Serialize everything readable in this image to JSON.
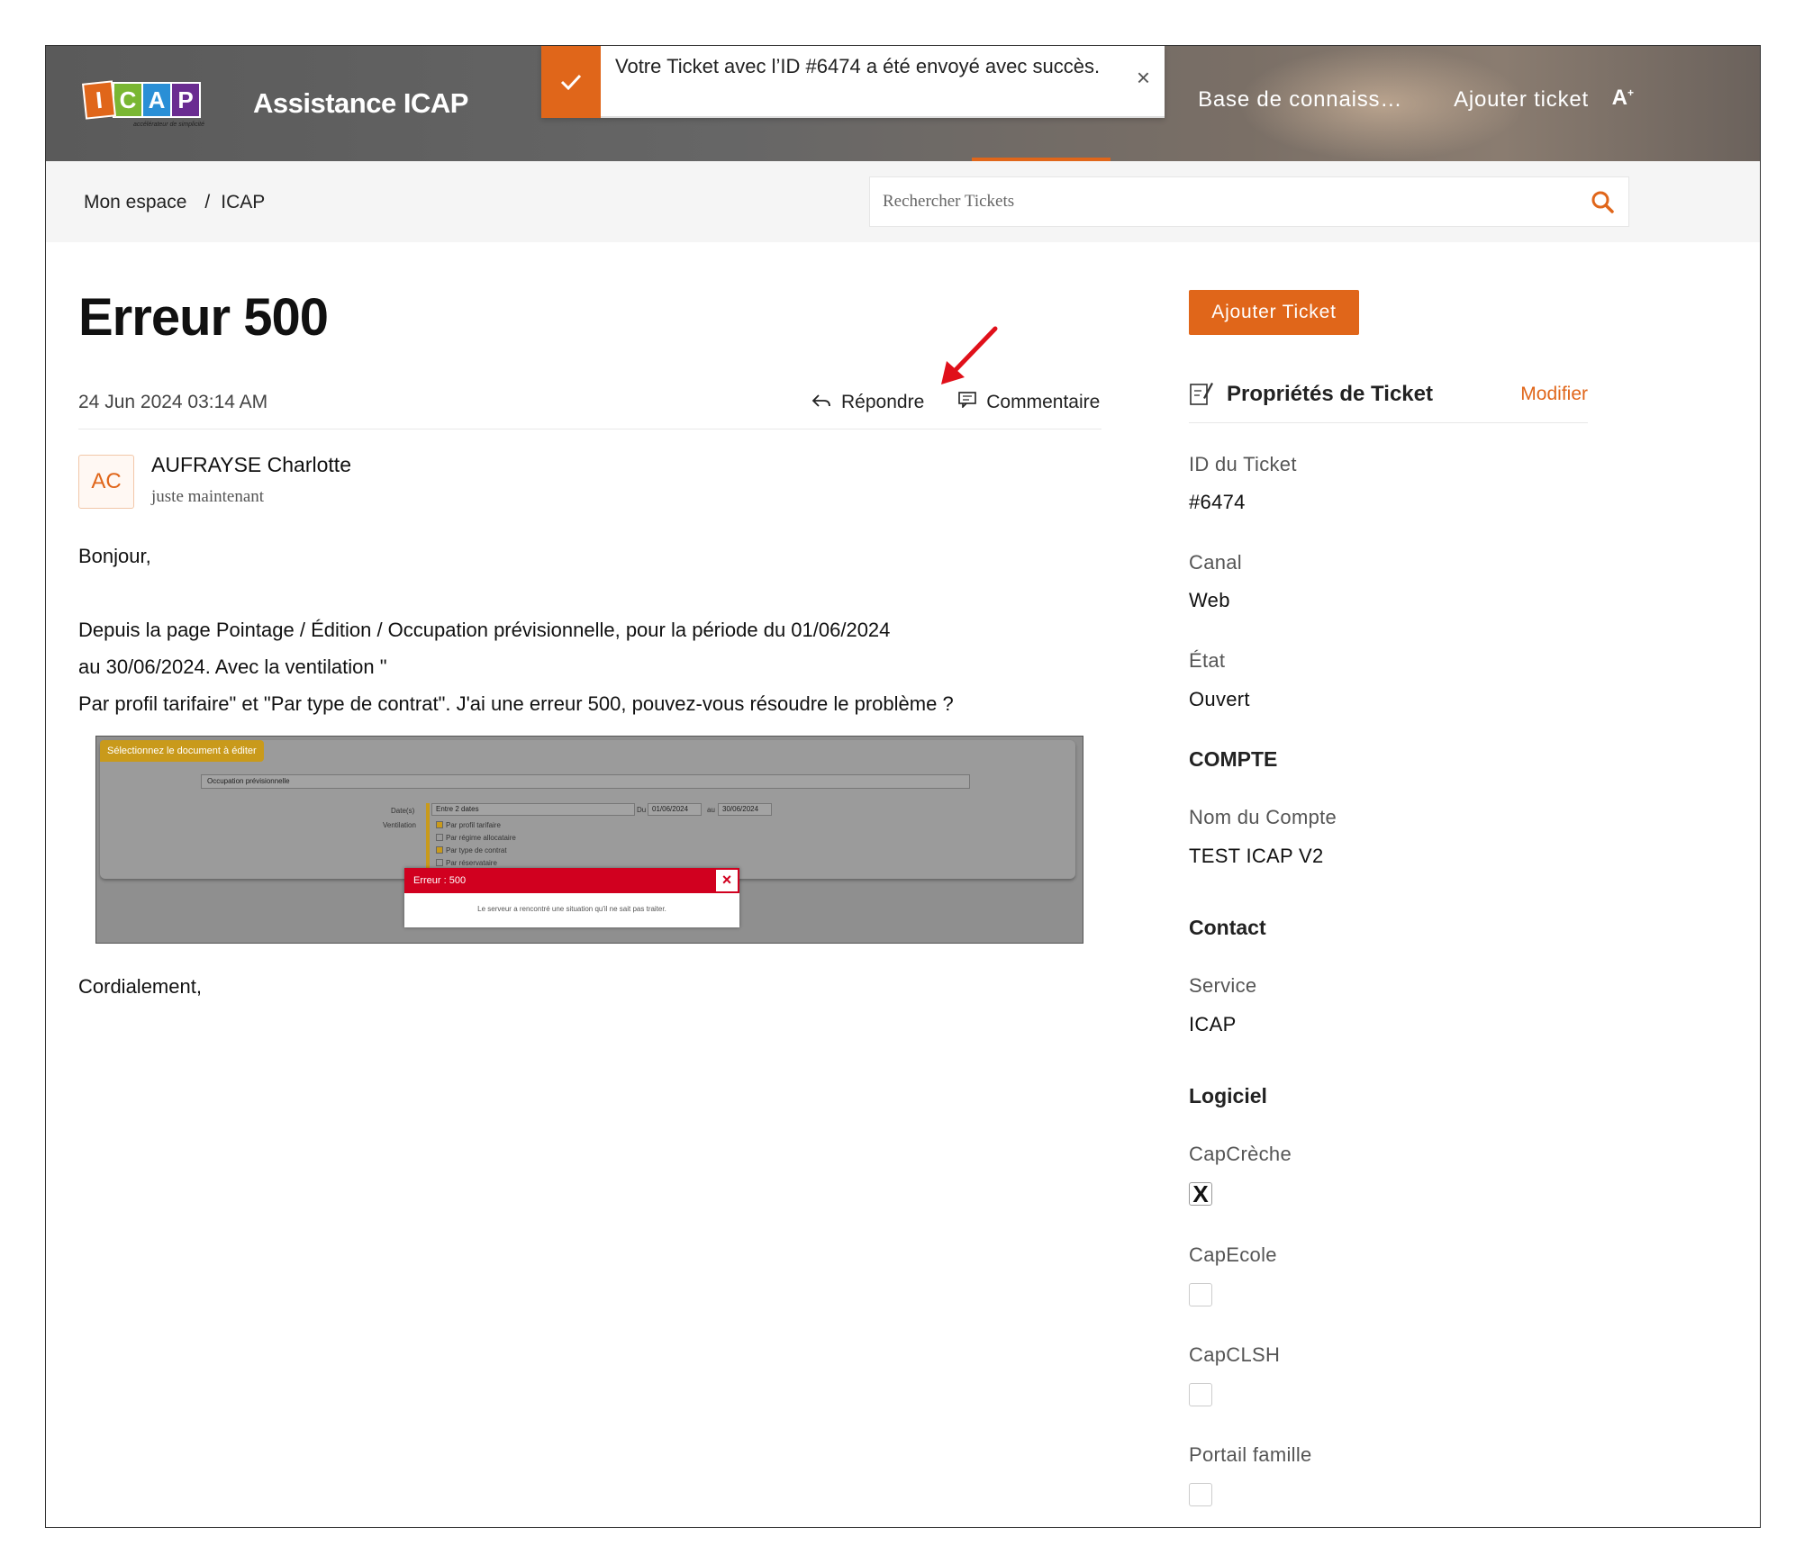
{
  "header": {
    "logo_letters": [
      "I",
      "C",
      "A",
      "P"
    ],
    "logo_colors": [
      "#e0661a",
      "#7ab733",
      "#2a8fd6",
      "#6a2c91"
    ],
    "logo_tagline": "accélérateur de simplicité",
    "app_title": "Assistance ICAP",
    "nav": {
      "knowledge_base": "Base de connaissances",
      "add_ticket": "Ajouter ticket",
      "a11y": "A"
    },
    "accent": "#e0661a"
  },
  "toast": {
    "message": "Votre Ticket avec l’ID #6474 a été envoyé avec succès.",
    "close": "×"
  },
  "breadcrumb": {
    "home": "Mon espace",
    "sep": "/",
    "current": "ICAP"
  },
  "search": {
    "placeholder": "Rechercher Tickets"
  },
  "ticket": {
    "title": "Erreur 500",
    "date": "24 Jun 2024 03:14 AM",
    "reply_label": "Répondre",
    "comment_label": "Commentaire",
    "author_initials": "AC",
    "author_name": "AUFRAYSE Charlotte",
    "author_time": "juste maintenant",
    "body": {
      "greeting": "Bonjour,",
      "line1": "Depuis la page Pointage /  Édition / Occupation prévisionnelle, pour la période du 01/06/2024",
      "line2": "au 30/06/2024.  Avec la ventilation \"",
      "line3": "Par profil tarifaire\" et \"Par type de contrat\". J'ai une erreur 500, pouvez-vous résoudre le problème ?",
      "closing": "Cordialement,"
    },
    "attachment": {
      "tag": "Sélectionnez le document à éditer",
      "select_value": "Occupation prévisionnelle",
      "label_dates": "Date(s)",
      "label_ventilation": "Ventilation",
      "range_select": "Entre 2 dates",
      "from_label": "Du",
      "from_date": "01/06/2024",
      "to_label": "au",
      "to_date": "30/06/2024",
      "options": [
        {
          "label": "Par profil tarifaire",
          "checked": true
        },
        {
          "label": "Par régime allocataire",
          "checked": false
        },
        {
          "label": "Par type de contrat",
          "checked": true
        },
        {
          "label": "Par réservataire",
          "checked": false
        }
      ],
      "error_title": "Erreur : 500",
      "error_close": "×",
      "error_message": "Le serveur a rencontré une situation qu'il ne sait pas traiter."
    }
  },
  "sidebar": {
    "add_button": "Ajouter Ticket",
    "props_title": "Propriétés de Ticket",
    "edit_label": "Modifier",
    "id_label": "ID du Ticket",
    "id_value": "#6474",
    "channel_label": "Canal",
    "channel_value": "Web",
    "state_label": "État",
    "state_value": "Ouvert",
    "account_section": "COMPTE",
    "account_name_label": "Nom du Compte",
    "account_name_value": "TEST ICAP V2",
    "contact_section": "Contact",
    "service_label": "Service",
    "service_value": "ICAP",
    "software_section": "Logiciel",
    "software": [
      {
        "label": "CapCrèche",
        "checked": true,
        "mark": "X"
      },
      {
        "label": "CapEcole",
        "checked": false
      },
      {
        "label": "CapCLSH",
        "checked": false
      },
      {
        "label": "Portail famille",
        "checked": false
      }
    ]
  }
}
